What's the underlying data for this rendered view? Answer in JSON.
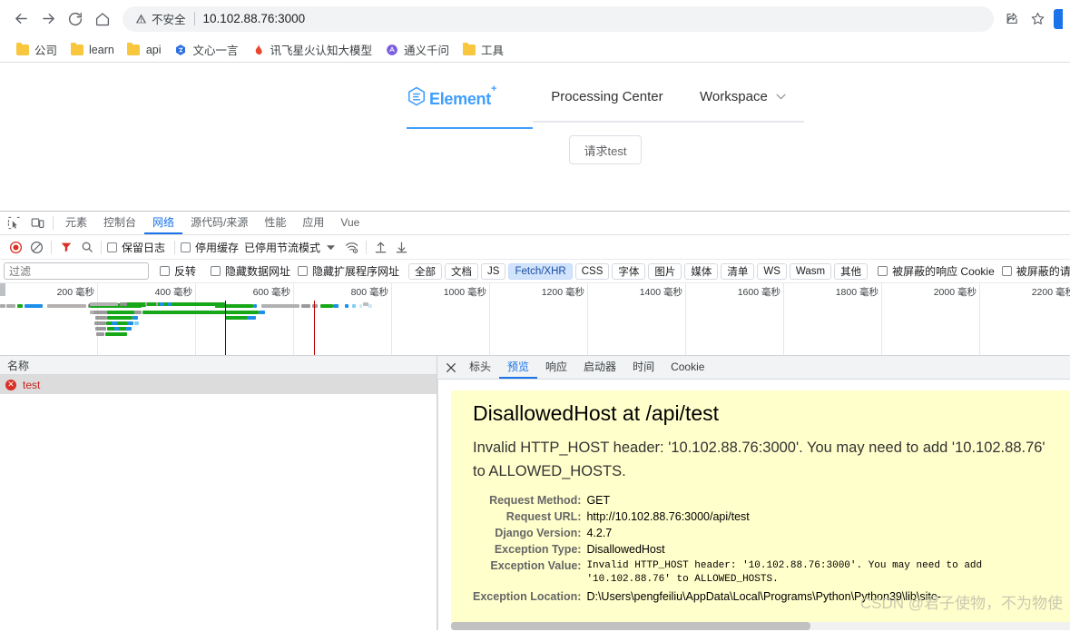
{
  "browser": {
    "nav": {
      "back": "back-arrow",
      "forward": "forward-arrow",
      "reload": "reload",
      "home": "home"
    },
    "omnibox": {
      "warning_label": "不安全",
      "url": "10.102.88.76:3000"
    },
    "actions": {
      "share": "share-icon",
      "bookmark": "star-icon"
    },
    "bookmarks": [
      {
        "label": "公司",
        "icon": "folder",
        "color": "#f8c73e"
      },
      {
        "label": "learn",
        "icon": "folder",
        "color": "#f8c73e"
      },
      {
        "label": "api",
        "icon": "folder",
        "color": "#f8c73e"
      },
      {
        "label": "文心一言",
        "icon": "site",
        "color": "#2a6ee0"
      },
      {
        "label": "讯飞星火认知大模型",
        "icon": "site",
        "color": "#e8462c"
      },
      {
        "label": "通义千问",
        "icon": "site",
        "color": "#6a4fd8"
      },
      {
        "label": "工具",
        "icon": "folder",
        "color": "#f8c73e"
      }
    ]
  },
  "page": {
    "brand": "Element",
    "brand_sup": "+",
    "nav_items": [
      {
        "label": "Processing Center",
        "has_caret": false
      },
      {
        "label": "Workspace",
        "has_caret": true
      }
    ],
    "button": "请求test"
  },
  "devtools": {
    "panels": [
      "元素",
      "控制台",
      "网络",
      "源代码/来源",
      "性能",
      "应用",
      "Vue"
    ],
    "active_panel": "网络",
    "toolbar": {
      "record": "record-icon",
      "clear": "clear-icon",
      "filter": "filter-icon",
      "search": "search-icon",
      "preserve_log": "保留日志",
      "disable_cache": "停用缓存",
      "throttling": "已停用节流模式",
      "network_conditions": "wifi-settings-icon",
      "import_har": "import-icon",
      "export_har": "export-icon"
    },
    "filterbar": {
      "placeholder": "过滤",
      "invert": "反转",
      "hide_data_urls": "隐藏数据网址",
      "hide_ext_urls": "隐藏扩展程序网址",
      "types": [
        "全部",
        "文档",
        "JS",
        "Fetch/XHR",
        "CSS",
        "字体",
        "图片",
        "媒体",
        "清单",
        "WS",
        "Wasm",
        "其他"
      ],
      "active_type": "Fetch/XHR",
      "blocked_cookies": "被屏蔽的响应 Cookie",
      "blocked_requests": "被屏蔽的请"
    },
    "overview": {
      "unit": "毫秒",
      "ticks": [
        200,
        400,
        600,
        800,
        1000,
        1200,
        1400,
        1600,
        1800,
        2000,
        2200
      ],
      "dom_content_loaded_color": "#0d0d8c",
      "load_color": "#b80000"
    },
    "list": {
      "header": "名称",
      "rows": [
        {
          "name": "test",
          "status": "error"
        }
      ]
    },
    "detail": {
      "tabs": [
        "标头",
        "预览",
        "响应",
        "启动器",
        "时间",
        "Cookie"
      ],
      "active_tab": "预览",
      "close": "close-icon"
    }
  },
  "django_error": {
    "heading": "DisallowedHost at /api/test",
    "message": "Invalid HTTP_HOST header: '10.102.88.76:3000'. You may need to add '10.102.88.76' to ALLOWED_HOSTS.",
    "rows": [
      {
        "label": "Request Method:",
        "value": "GET",
        "mono": false
      },
      {
        "label": "Request URL:",
        "value": "http://10.102.88.76:3000/api/test",
        "mono": false
      },
      {
        "label": "Django Version:",
        "value": "4.2.7",
        "mono": false
      },
      {
        "label": "Exception Type:",
        "value": "DisallowedHost",
        "mono": false
      },
      {
        "label": "Exception Value:",
        "value": "Invalid HTTP_HOST header: '10.102.88.76:3000'. You may need to add '10.102.88.76' to ALLOWED_HOSTS.",
        "mono": true
      },
      {
        "label": "Exception Location:",
        "value": "D:\\Users\\pengfeiliu\\AppData\\Local\\Programs\\Python\\Python39\\lib\\site-",
        "mono": false
      }
    ],
    "watermark": "CSDN @君子使物，不为物使",
    "background": "#ffffcc"
  }
}
